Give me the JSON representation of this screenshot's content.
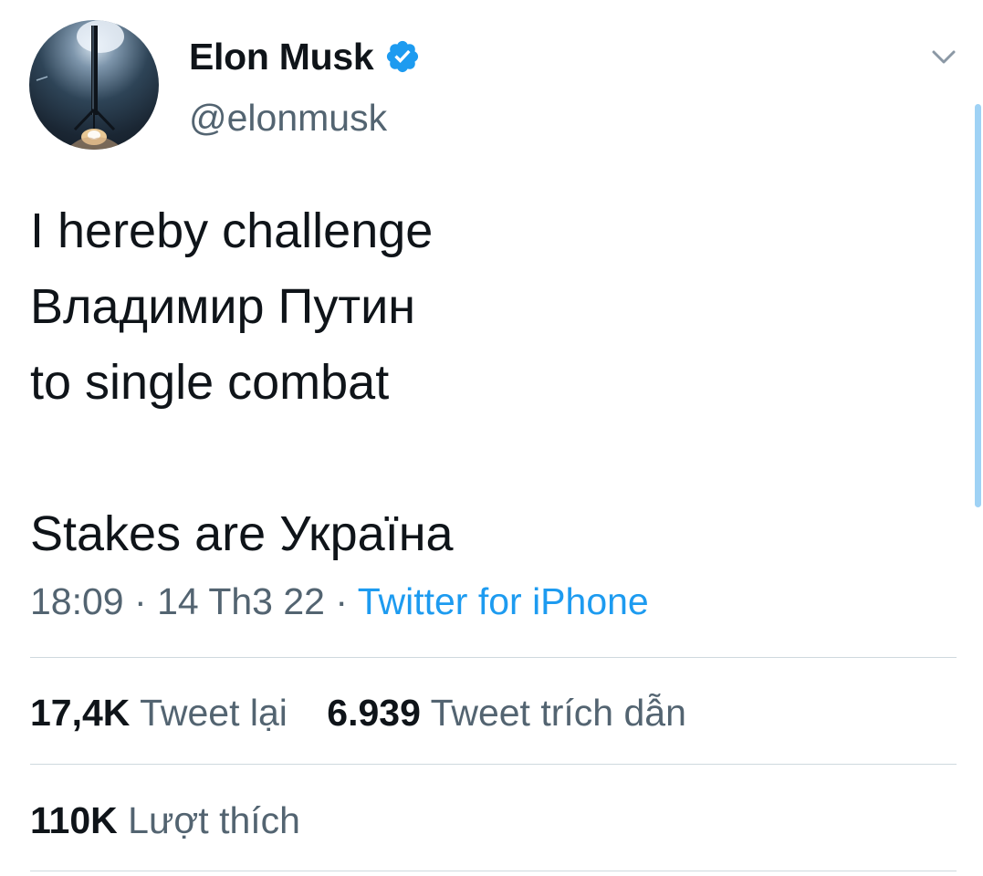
{
  "author": {
    "display_name": "Elon Musk",
    "handle": "@elonmusk",
    "verified": true,
    "avatar_icon": "rocket-landing-avatar"
  },
  "tweet": {
    "lines": [
      "I hereby challenge",
      "Владимир Путин",
      "to single combat",
      "",
      "Stakes are Україна"
    ]
  },
  "meta": {
    "time": "18:09",
    "separator": "·",
    "date": "14 Th3 22",
    "source": "Twitter for iPhone"
  },
  "stats": {
    "retweets_count": "17,4K",
    "retweets_label": "Tweet lại",
    "quotes_count": "6.939",
    "quotes_label": "Tweet trích dẫn",
    "likes_count": "110K",
    "likes_label": "Lượt thích"
  },
  "colors": {
    "accent": "#1d9bf0",
    "secondary_text": "#536471",
    "primary_text": "#0f1419",
    "divider": "#cfd9de",
    "scrollbar": "#9fd2f5"
  },
  "icons": {
    "verified": "verified-badge-icon",
    "menu": "chevron-down-icon"
  }
}
